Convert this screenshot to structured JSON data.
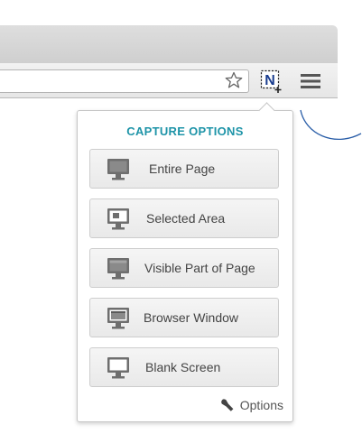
{
  "browser": {
    "star_icon": "star-outline-icon",
    "extension_icon": "nimbus-capture-icon",
    "extension_letter": "N",
    "menu_icon": "hamburger-menu-icon"
  },
  "popup": {
    "title": "CAPTURE OPTIONS",
    "options": [
      {
        "label": "Entire Page",
        "icon": "monitor-entire-page-icon"
      },
      {
        "label": "Selected Area",
        "icon": "monitor-selected-area-icon"
      },
      {
        "label": "Visible Part of Page",
        "icon": "monitor-visible-part-icon"
      },
      {
        "label": "Browser Window",
        "icon": "monitor-browser-window-icon"
      },
      {
        "label": "Blank Screen",
        "icon": "monitor-blank-screen-icon"
      }
    ],
    "footer_label": "Options",
    "footer_icon": "wrench-icon"
  },
  "colors": {
    "accent": "#1e94a8",
    "extension_blue": "#1a3d8f",
    "callout_line": "#2a5ea8"
  }
}
